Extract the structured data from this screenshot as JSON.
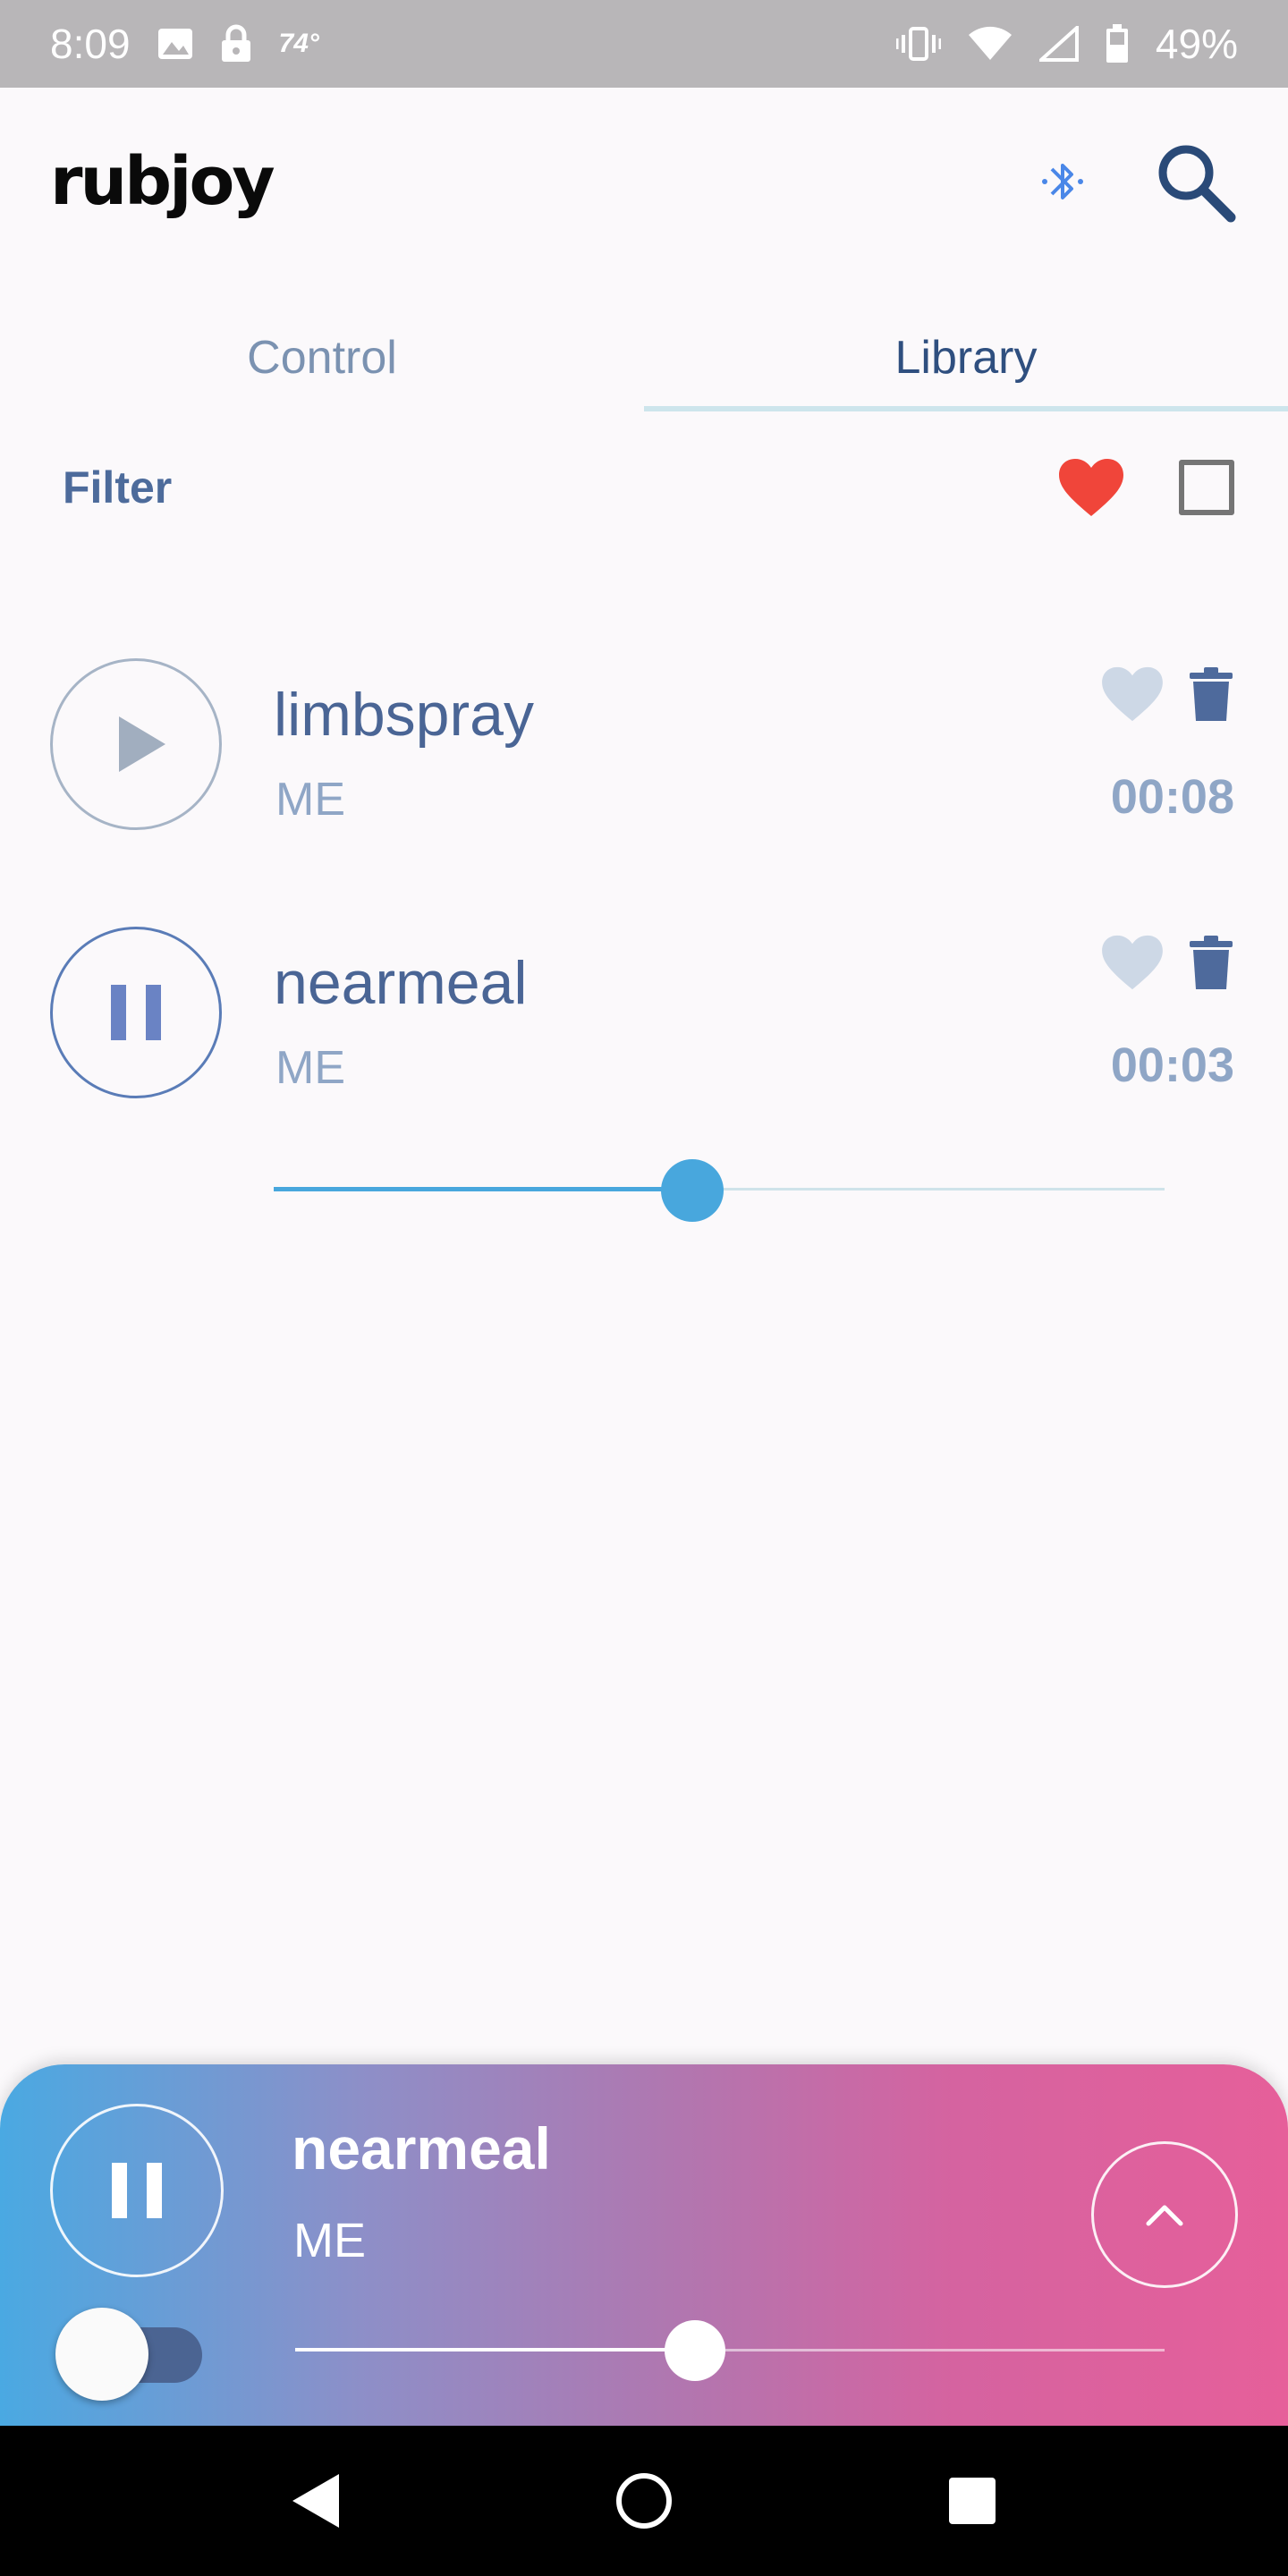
{
  "status_bar": {
    "time": "8:09",
    "temperature": "74°",
    "battery": "49%",
    "icons": [
      "image-icon",
      "lock-icon",
      "vibrate-icon",
      "wifi-icon",
      "signal-icon",
      "battery-icon"
    ]
  },
  "header": {
    "logo": "rubjoy",
    "bluetooth_icon": "bluetooth-icon",
    "search_icon": "search-icon",
    "accent_color": "#4a87e8"
  },
  "tabs": [
    {
      "label": "Control",
      "active": false
    },
    {
      "label": "Library",
      "active": true
    }
  ],
  "filter": {
    "label": "Filter",
    "favorite_icon": "heart-icon",
    "favorite_color": "#f0453a",
    "select_all_icon": "checkbox-icon"
  },
  "tracks": [
    {
      "title": "limbspray",
      "artist": "ME",
      "duration": "00:08",
      "state": "play-icon",
      "favorited": false
    },
    {
      "title": "nearmeal",
      "artist": "ME",
      "duration": "00:03",
      "state": "pause-icon",
      "favorited": false
    }
  ],
  "inline_progress": 0.47,
  "player": {
    "title": "nearmeal",
    "artist": "ME",
    "state": "pause-icon",
    "progress": 0.46,
    "toggle_on": false,
    "expand_icon": "chevron-up-icon"
  },
  "nav": {
    "icons": [
      "back-icon",
      "home-icon",
      "recents-icon"
    ]
  }
}
